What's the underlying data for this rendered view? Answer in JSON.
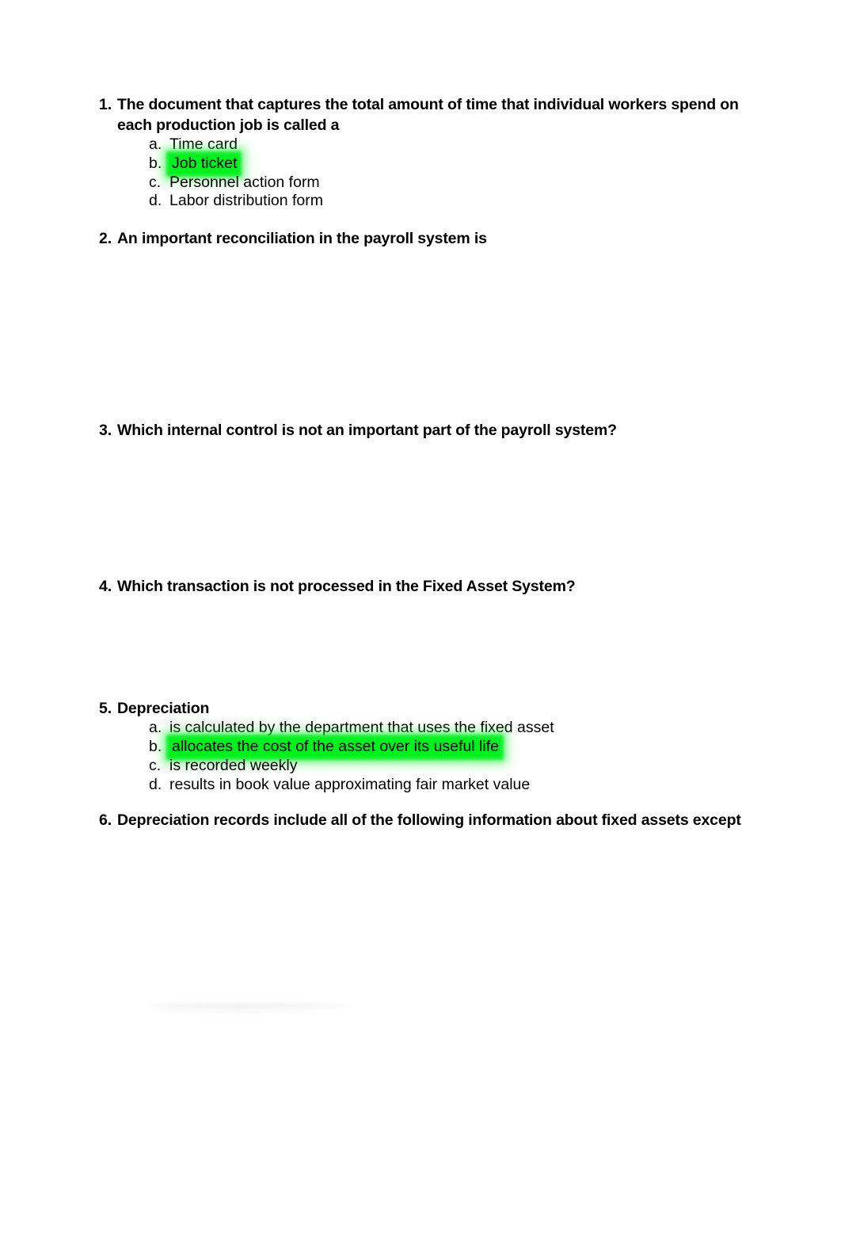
{
  "document": {
    "type": "multiple-choice-quiz",
    "page_background": "#ffffff",
    "highlight_color": "#00f11d",
    "text_color": "#000000"
  },
  "questions": [
    {
      "number": "1.",
      "text": "The document that captures the total amount of time that individual workers spend on each production job is called a",
      "options": [
        {
          "letter": "a.",
          "text": "Time card",
          "highlighted": false
        },
        {
          "letter": "b.",
          "text": "Job ticket",
          "highlighted": true
        },
        {
          "letter": "c.",
          "text": "Personnel action form",
          "highlighted": false
        },
        {
          "letter": "d.",
          "text": "Labor distribution form",
          "highlighted": false
        }
      ]
    },
    {
      "number": "2.",
      "text": "An important reconciliation in the payroll system is",
      "options": []
    },
    {
      "number": "3.",
      "text": "Which internal control is not an important part of the payroll system?",
      "options": []
    },
    {
      "number": "4.",
      "text": "Which transaction is not processed in the Fixed Asset System?",
      "options": []
    },
    {
      "number": "5.",
      "text": "Depreciation",
      "options": [
        {
          "letter": "a.",
          "text": "is calculated by the department that uses the fixed asset",
          "highlighted": false
        },
        {
          "letter": "b.",
          "text": "allocates the cost of the asset over its useful life",
          "highlighted": true
        },
        {
          "letter": "c.",
          "text": "is recorded weekly",
          "highlighted": false
        },
        {
          "letter": "d.",
          "text": "results in book value approximating fair market value",
          "highlighted": false
        }
      ]
    },
    {
      "number": "6.",
      "text": "Depreciation records include all of the following information about fixed assets except",
      "options": []
    }
  ]
}
